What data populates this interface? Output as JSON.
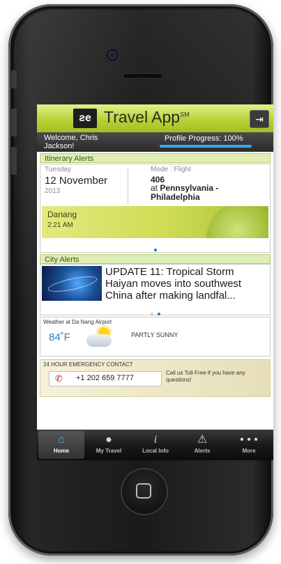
{
  "app": {
    "title": "Travel App",
    "title_mark": "SM",
    "logo_text": "ƨe",
    "logout_icon": "logout-icon"
  },
  "welcome": {
    "text": "Welcome, Chris Jackson!",
    "profile_progress_label": "Profile Progress: 100%",
    "profile_progress_value": 1.0
  },
  "itinerary": {
    "header": "Itinerary Alerts",
    "day": "Tuesday",
    "date": "12 November",
    "year": "2013",
    "mode": "Mode : Flight",
    "flight_number": "406",
    "destination_prefix": "at",
    "destination": "Pennsylvania - Philadelphia",
    "banner_city": "Danang",
    "banner_time": "2:21 AM",
    "pager_total": 1,
    "pager_active": 1
  },
  "city_alerts": {
    "header": "City Alerts",
    "headline": "UPDATE 11: Tropical Storm Haiyan moves into southwest China after making landfal...",
    "pager_total": 2,
    "pager_active": 2
  },
  "weather": {
    "label": "Weather at Da Nang Airport",
    "temperature": "84˚F",
    "condition": "PARTLY SUNNY",
    "icon": "partly-sunny-icon"
  },
  "emergency": {
    "title": "24 HOUR EMERGENCY CONTACT",
    "phone": "+1 202 659 7777",
    "note": "Call us Toll-Free if you have any questions!",
    "icon": "phone-icon"
  },
  "tabs": [
    {
      "label": "Home",
      "icon": "home-icon",
      "active": true
    },
    {
      "label": "My Travel",
      "icon": "balloon-icon",
      "active": false
    },
    {
      "label": "Local Info",
      "icon": "info-icon",
      "active": false
    },
    {
      "label": "Alerts",
      "icon": "warning-icon",
      "active": false
    },
    {
      "label": "More",
      "icon": "more-icon",
      "active": false
    }
  ],
  "colors": {
    "header_green": "#b9d238",
    "accent_blue": "#3ba8e8",
    "section_green": "#dfeeb4",
    "phone_red": "#c21818"
  }
}
